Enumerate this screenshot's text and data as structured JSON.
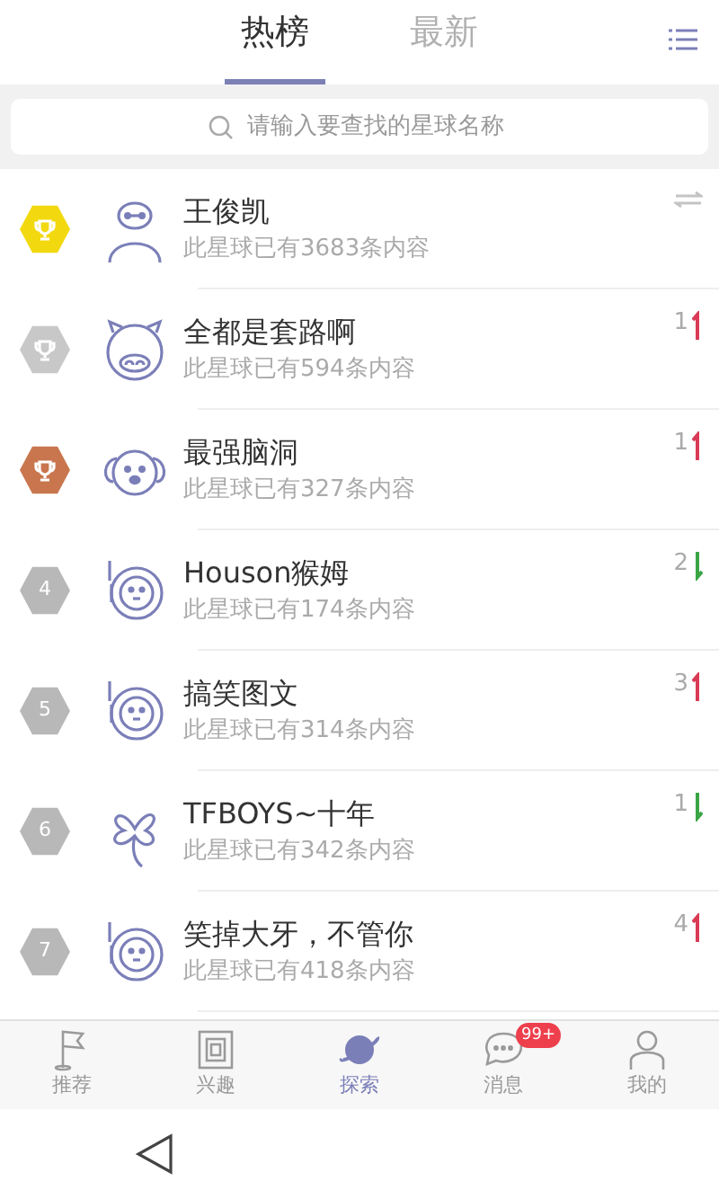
{
  "tabs": [
    {
      "label": "热榜",
      "selected": true
    },
    {
      "label": "最新",
      "selected": false
    }
  ],
  "search": {
    "placeholder": "请输入要查找的星球名称"
  },
  "rows": [
    {
      "kind": "robot",
      "badge": {
        "color": "#f2d90f"
      },
      "name": "王俊凯",
      "count": "此星球已有3683条内容",
      "change": {
        "kind": "same"
      }
    },
    {
      "kind": "pig",
      "badge": {
        "color": "#c8c8c8"
      },
      "name": "全都是套路啊",
      "count": "此星球已有594条内容",
      "change": {
        "kind": "up",
        "value": "1"
      }
    },
    {
      "kind": "dog",
      "badge": {
        "color": "#c9764f"
      },
      "name": "最强脑洞",
      "count": "此星球已有327条内容",
      "change": {
        "kind": "up",
        "value": "1"
      }
    },
    {
      "kind": "astronaut",
      "badge": {
        "color": "#b8b8b8",
        "rank": "4"
      },
      "name": "Houson猴姆",
      "count": "此星球已有174条内容",
      "change": {
        "kind": "down",
        "value": "2"
      }
    },
    {
      "kind": "astronaut",
      "badge": {
        "color": "#b8b8b8",
        "rank": "5"
      },
      "name": "搞笑图文",
      "count": "此星球已有314条内容",
      "change": {
        "kind": "up",
        "value": "3"
      }
    },
    {
      "kind": "clover",
      "badge": {
        "color": "#b8b8b8",
        "rank": "6"
      },
      "name": "TFBOYS~十年",
      "count": "此星球已有342条内容",
      "change": {
        "kind": "down",
        "value": "1"
      }
    },
    {
      "kind": "astronaut",
      "badge": {
        "color": "#b8b8b8",
        "rank": "7"
      },
      "name": "笑掉大牙，不管你",
      "count": "此星球已有418条内容",
      "change": {
        "kind": "up",
        "value": "4"
      }
    }
  ],
  "nav": [
    {
      "kind": "flag",
      "label": "推荐",
      "selected": false
    },
    {
      "kind": "square",
      "label": "兴趣",
      "selected": false
    },
    {
      "kind": "planet",
      "label": "探索",
      "selected": true
    },
    {
      "kind": "chat",
      "label": "消息",
      "selected": false,
      "badge": "99+"
    },
    {
      "kind": "person",
      "label": "我的",
      "selected": false
    }
  ]
}
